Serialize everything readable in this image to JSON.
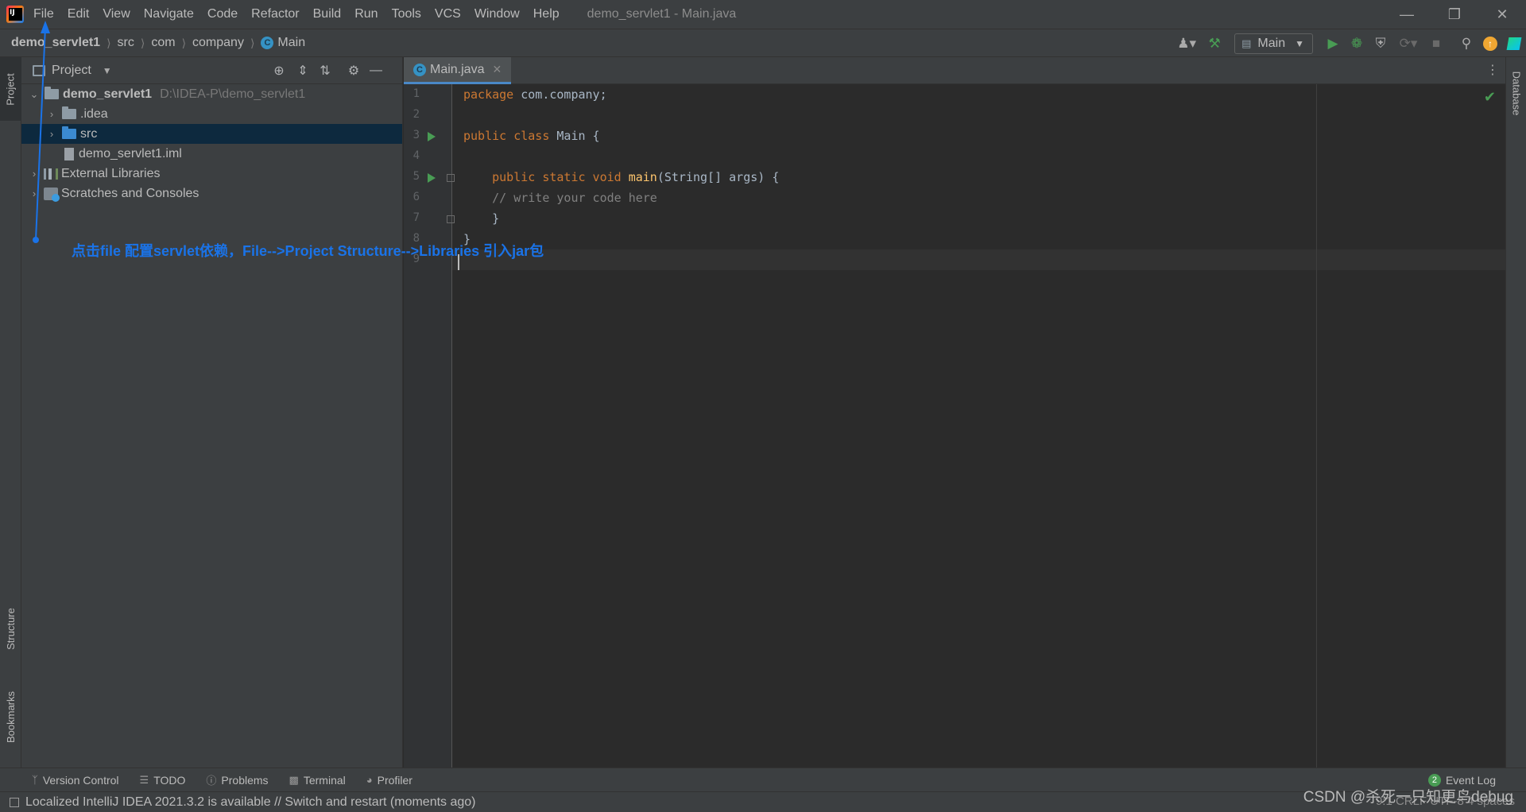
{
  "menubar": {
    "items": [
      "File",
      "Edit",
      "View",
      "Navigate",
      "Code",
      "Refactor",
      "Build",
      "Run",
      "Tools",
      "VCS",
      "Window",
      "Help"
    ],
    "window_title": "demo_servlet1 - Main.java"
  },
  "breadcrumb": {
    "project": "demo_servlet1",
    "parts": [
      "src",
      "com",
      "company"
    ],
    "current": "Main"
  },
  "toolbar": {
    "run_config": "Main"
  },
  "left_stripe": {
    "project": "Project",
    "structure": "Structure",
    "bookmarks": "Bookmarks"
  },
  "project_panel": {
    "title": "Project",
    "tree": [
      {
        "label": "demo_servlet1",
        "hint": "D:\\IDEA-P\\demo_servlet1"
      },
      {
        "label": ".idea"
      },
      {
        "label": "src"
      },
      {
        "label": "demo_servlet1.iml"
      },
      {
        "label": "External Libraries"
      },
      {
        "label": "Scratches and Consoles"
      }
    ]
  },
  "annotation": "点击file 配置servlet依赖，File-->Project Structure-->Libraries 引入jar包",
  "editor": {
    "tab": "Main.java",
    "line_numbers": [
      "1",
      "2",
      "3",
      "4",
      "5",
      "6",
      "7",
      "8",
      "9"
    ],
    "code": {
      "l1_kw": "package",
      "l1_rest": " com.company;",
      "l3_kw": "public class",
      "l3_rest": " Main {",
      "l5_kw": "    public static void",
      "l5_fn": " main",
      "l5_rest": "(String[] args) {",
      "l6": "    // write your code here",
      "l7": "    }",
      "l8": "}"
    }
  },
  "right_stripe": {
    "database": "Database"
  },
  "bottom_tools": [
    "Version Control",
    "TODO",
    "Problems",
    "Terminal",
    "Profiler"
  ],
  "event_log": {
    "count": "2",
    "label": "Event Log"
  },
  "statusbar": {
    "message": "Localized IntelliJ IDEA 2021.3.2 is available // Switch and restart (moments ago)",
    "right": "9:1   CRLF   UTF-8   4 spaces"
  },
  "watermark": "CSDN @杀死一只知更鸟debug",
  "colors": {
    "accent": "#4a88c7",
    "annotation": "#1a73e8",
    "run_green": "#499c54",
    "keyword": "#cc7832"
  }
}
